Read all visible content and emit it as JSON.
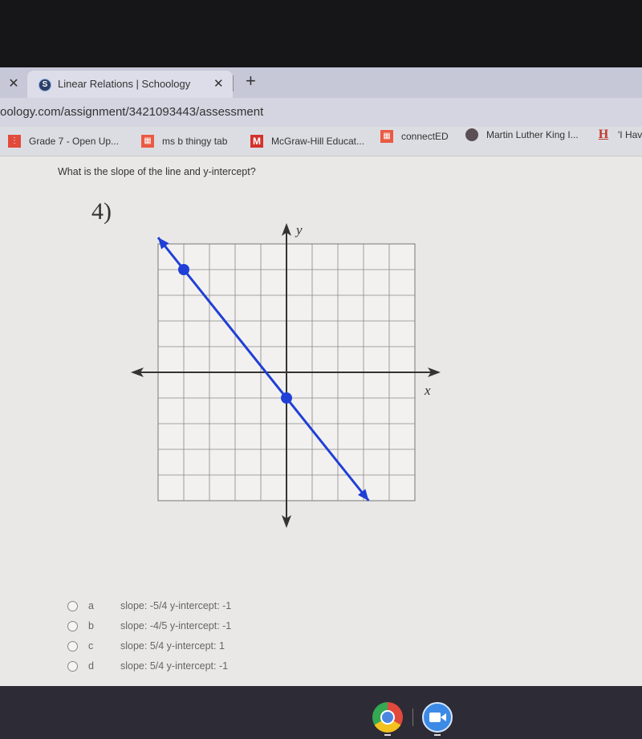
{
  "browser": {
    "tabs": [
      {
        "label": "",
        "active": false
      },
      {
        "label": "Linear Relations | Schoology",
        "favicon": "S",
        "active": true
      }
    ],
    "close_glyph": "✕",
    "new_tab_glyph": "+",
    "url": "oology.com/assignment/3421093443/assessment",
    "bookmarks": [
      {
        "label": "Grade 7 - Open Up...",
        "icon": "open-up-icon"
      },
      {
        "label": "ms b thingy tab",
        "icon": "grid-icon"
      },
      {
        "label": "McGraw-Hill Educat...",
        "icon": "mcgraw-hill-icon",
        "glyph": "M"
      },
      {
        "label": "connectED",
        "icon": "connected-icon"
      },
      {
        "label": "Martin Luther King I...",
        "icon": "globe-icon"
      },
      {
        "label": "'I Hav",
        "icon": "history-icon",
        "glyph": "H"
      }
    ]
  },
  "question": {
    "prompt": "What is the slope of the line and y-intercept?",
    "number": "4)"
  },
  "chart_data": {
    "type": "line",
    "title": "",
    "xlabel": "x",
    "ylabel": "y",
    "xlim": [
      -5,
      5
    ],
    "ylim": [
      -5,
      5
    ],
    "grid": true,
    "line_color": "#1f3fd6",
    "points": [
      {
        "x": -4,
        "y": 4
      },
      {
        "x": 0,
        "y": -1
      }
    ],
    "line": {
      "slope": -1.25,
      "intercept": -1,
      "x_start": -5,
      "x_end": 3.2
    }
  },
  "options": [
    {
      "letter": "a",
      "text": "slope: -5/4 y-intercept: -1"
    },
    {
      "letter": "b",
      "text": "slope: -4/5 y-intercept: -1"
    },
    {
      "letter": "c",
      "text": "slope: 5/4 y-intercept: 1"
    },
    {
      "letter": "d",
      "text": "slope: 5/4 y-intercept: -1"
    }
  ],
  "shelf": {
    "apps": [
      {
        "name": "Chrome"
      },
      {
        "name": "Zoom"
      }
    ]
  }
}
